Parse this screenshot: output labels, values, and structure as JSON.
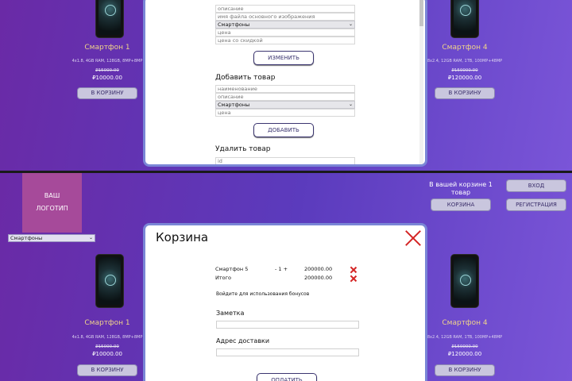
{
  "top": {
    "products": [
      {
        "name": "Смартфон 1",
        "specs": "4x1.8, 4GB RAM, 128GB, 8MP+8MP",
        "old_price": "₽15000.00",
        "price": "₽10000.00",
        "button": "В КОРЗИНУ"
      },
      {
        "name": "Смартфон 4",
        "specs": "8x2.4, 12GB RAM, 1TB, 100MP+48MP",
        "old_price": "₽150000.00",
        "price": "₽120000.00",
        "button": "В КОРЗИНУ"
      }
    ],
    "admin": {
      "edit_fields": {
        "description": "описание",
        "image_file": "имя файла основного изображения",
        "category": "Смартфоны",
        "price": "цена",
        "discount_price": "цена со скидкой"
      },
      "edit_button": "ИЗМЕНИТЬ",
      "add_heading": "Добавить товар",
      "add_fields": {
        "name": "наименование",
        "description": "описание",
        "category": "Смартфоны",
        "price": "цена"
      },
      "add_button": "ДОБАВИТЬ",
      "delete_heading": "Удалить товар",
      "delete_field": "id"
    }
  },
  "bottom": {
    "logo": {
      "line1": "ВАШ",
      "line2": "ЛОГОТИП"
    },
    "category_select": "Смартфоны",
    "cart_info": "В вашей корзине 1 товар",
    "login_button": "ВХОД",
    "cart_button": "КОРЗИНА",
    "register_button": "РЕГИСТРАЦИЯ",
    "products": [
      {
        "name": "Смартфон 1",
        "specs": "4x1.8, 4GB RAM, 128GB, 8MP+8MP",
        "old_price": "₽15000.00",
        "price": "₽10000.00",
        "button": "В КОРЗИНУ"
      },
      {
        "name": "Смартфон 4",
        "specs": "8x2.4, 12GB RAM, 1TB, 100MP+48MP",
        "old_price": "₽150000.00",
        "price": "₽120000.00",
        "button": "В КОРЗИНУ"
      }
    ],
    "cart": {
      "title": "Корзина",
      "item": {
        "name": "Смартфон 5",
        "qty": "- 1 +",
        "price": "200000.00"
      },
      "total": {
        "label": "Итого",
        "price": "200000.00"
      },
      "bonus_text": "Войдите для использования бонусов",
      "note_label": "Заметка",
      "address_label": "Адрес доставки",
      "pay_button": "ОПЛАТИТЬ"
    }
  },
  "colors": {
    "accent": "#7a86d6",
    "danger": "#d42424",
    "price_name": "#f0d48a"
  }
}
